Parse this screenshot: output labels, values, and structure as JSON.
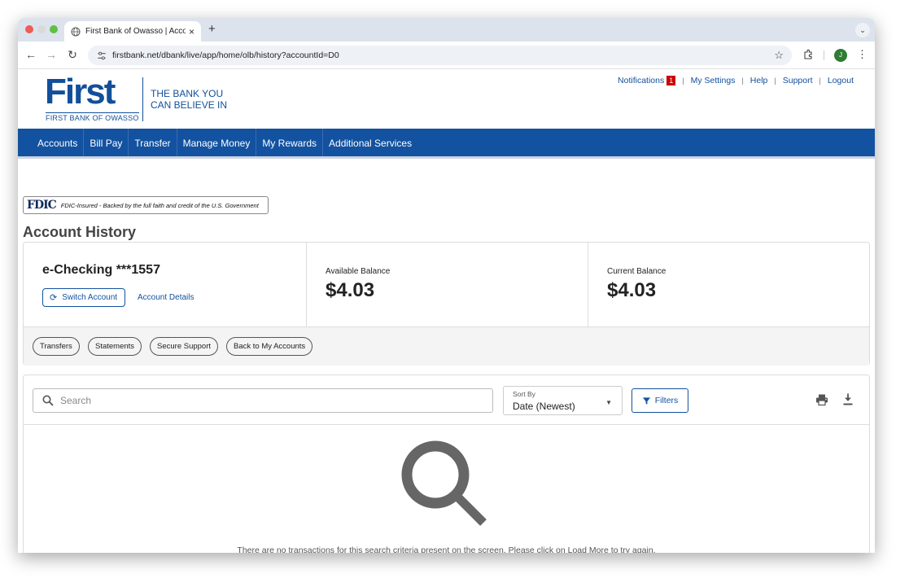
{
  "browser": {
    "tab_title": "First Bank of Owasso | Accou",
    "tab_close": "×",
    "new_tab": "+",
    "url": "firstbank.net/dbank/live/app/home/olb/history?accountId=D0",
    "profile_initial": "J",
    "nav": {
      "back": "←",
      "forward": "→",
      "reload": "↻"
    },
    "star": "☆",
    "menu": "⋮",
    "tab_dropdown": "⌄"
  },
  "header": {
    "logo_text": "First",
    "logo_sub": "FIRST BANK OF OWASSO",
    "tagline_1": "THE BANK YOU",
    "tagline_2": "CAN BELIEVE IN",
    "utility": {
      "notifications": "Notifications",
      "notif_count": "1",
      "settings": "My Settings",
      "help": "Help",
      "support": "Support",
      "logout": "Logout",
      "sep": "|"
    }
  },
  "nav": {
    "items": [
      "Accounts",
      "Bill Pay",
      "Transfer",
      "Manage Money",
      "My Rewards",
      "Additional Services"
    ]
  },
  "fdic": {
    "mark": "FDIC",
    "text": "FDIC-Insured - Backed by the full faith and credit of the U.S. Government"
  },
  "page": {
    "title": "Account History"
  },
  "account": {
    "name": "e-Checking ***1557",
    "switch_label": "Switch Account",
    "details_label": "Account Details",
    "available_label": "Available Balance",
    "available_value": "$4.03",
    "current_label": "Current Balance",
    "current_value": "$4.03"
  },
  "actions": [
    "Transfers",
    "Statements",
    "Secure Support",
    "Back to My Accounts"
  ],
  "history": {
    "search_placeholder": "Search",
    "sort_label": "Sort By",
    "sort_value": "Date (Newest)",
    "filters_label": "Filters",
    "empty_message": "There are no transactions for this search criteria present on the screen. Please click on Load More to try again."
  },
  "colors": {
    "brand_blue": "#1352a0",
    "badge_red": "#cc0000"
  },
  "icons": [
    "globe-icon",
    "tune-icon",
    "star-icon",
    "extension-icon",
    "switch-icon",
    "search-icon",
    "filter-icon",
    "print-icon",
    "download-icon",
    "large-search-icon"
  ]
}
